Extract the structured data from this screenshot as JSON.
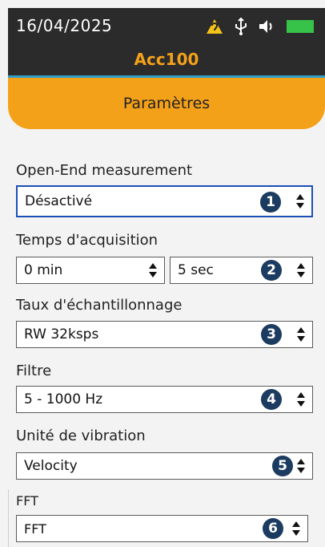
{
  "status": {
    "date": "16/04/2025",
    "device": "Acc100",
    "icons": [
      "hearing-warning-icon",
      "usb-icon",
      "speaker-icon",
      "battery-icon"
    ],
    "battery_color": "#37c24a"
  },
  "header": {
    "title": "Paramètres",
    "accent": "#f4a11a"
  },
  "fields": {
    "open_end": {
      "label": "Open-End measurement",
      "value": "Désactivé",
      "badge": "1"
    },
    "acq_time": {
      "label": "Temps d'acquisition",
      "min_value": "0 min",
      "sec_value": "5 sec",
      "badge": "2"
    },
    "sampling": {
      "label": "Taux d'échantillonnage",
      "value": "RW 32ksps",
      "badge": "3"
    },
    "filter": {
      "label": "Filtre",
      "value": "5 - 1000 Hz",
      "badge": "4"
    },
    "vib_unit": {
      "label": "Unité de vibration",
      "value": "Velocity",
      "badge": "5"
    },
    "fft": {
      "label": "FFT",
      "value": "FFT",
      "badge": "6"
    }
  }
}
